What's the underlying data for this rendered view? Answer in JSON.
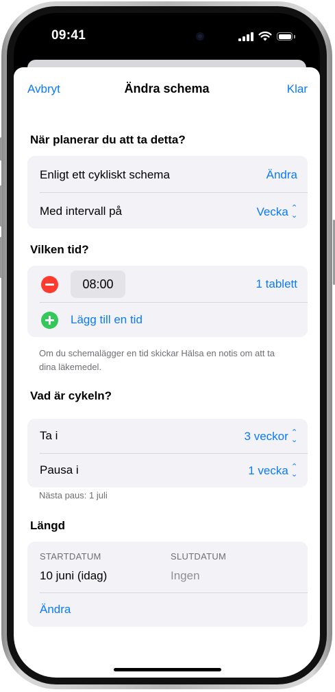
{
  "status_bar": {
    "time": "09:41",
    "icons": [
      "cellular-signal-icon",
      "wifi-icon",
      "battery-icon"
    ]
  },
  "nav": {
    "cancel": "Avbryt",
    "title": "Ändra schema",
    "done": "Klar"
  },
  "schedule": {
    "heading": "När planerar du att ta detta?",
    "rows": [
      {
        "label": "Enligt ett cykliskt schema",
        "value": "Ändra"
      },
      {
        "label": "Med intervall på",
        "value": "Vecka"
      }
    ]
  },
  "times": {
    "heading": "Vilken tid?",
    "entry": {
      "time": "08:00",
      "dose": "1 tablett"
    },
    "add_label": "Lägg till en tid",
    "note": "Om du schemalägger en tid skickar Hälsa en notis om att ta dina läkemedel."
  },
  "cycle": {
    "heading": "Vad är cykeln?",
    "rows": [
      {
        "label": "Ta i",
        "value": "3 veckor"
      },
      {
        "label": "Pausa i",
        "value": "1 vecka"
      }
    ],
    "footer": "Nästa paus: 1 juli"
  },
  "duration": {
    "heading": "Längd",
    "start_caption": "STARTDATUM",
    "start_value": "10 juni (idag)",
    "end_caption": "SLUTDATUM",
    "end_value": "Ingen",
    "change": "Ändra"
  },
  "colors": {
    "accent": "#0a7aff",
    "delete": "#ff3b30",
    "add": "#34c759",
    "group_bg": "#f2f2f7"
  }
}
